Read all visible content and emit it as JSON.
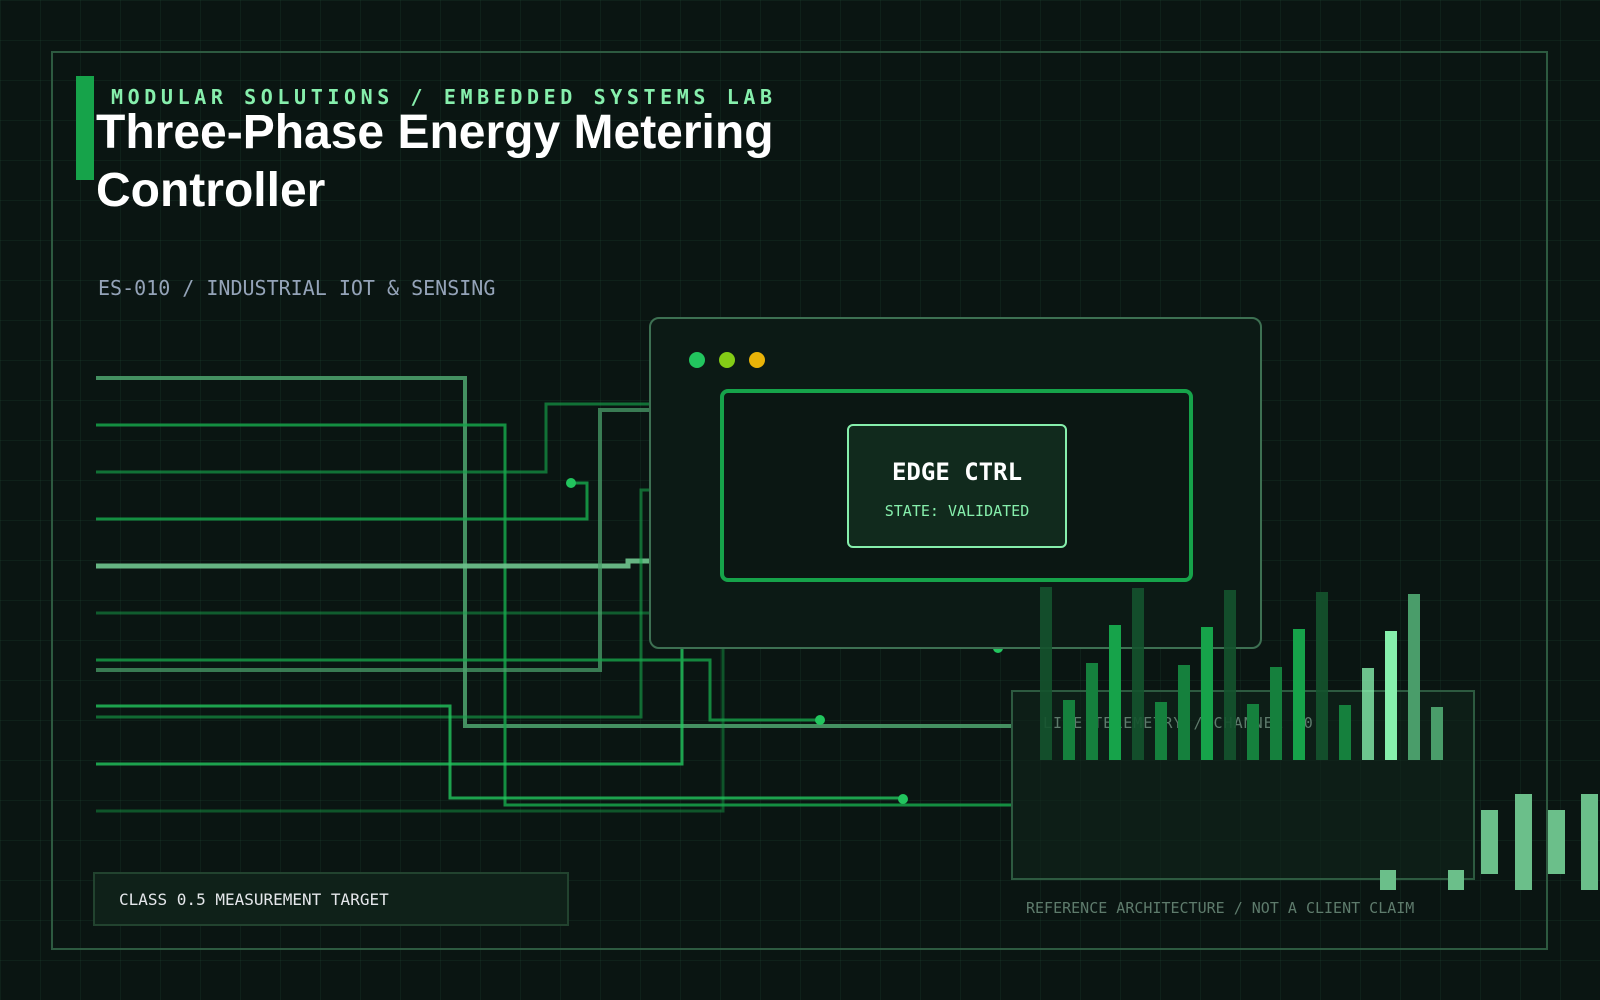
{
  "header": {
    "kicker": "MODULAR SOLUTIONS / EMBEDDED SYSTEMS LAB",
    "title": "Three-Phase Energy Metering Controller",
    "subtitle": "ES-010 / INDUSTRIAL IOT & SENSING"
  },
  "controller": {
    "title": "EDGE CTRL",
    "state": "STATE: VALIDATED",
    "window_dots": [
      "#22c55e",
      "#84cc16",
      "#eab308"
    ]
  },
  "telemetry": {
    "label": "LIVE TELEMETRY / CHANNEL 10"
  },
  "footer": {
    "badge": "CLASS 0.5 MEASUREMENT TARGET",
    "note": "REFERENCE ARCHITECTURE / NOT A CLIENT CLAIM"
  },
  "colors": {
    "background": "#0a1512",
    "accent": "#16a34a",
    "accent_light": "#86efac",
    "frame": "#2d5a40"
  }
}
